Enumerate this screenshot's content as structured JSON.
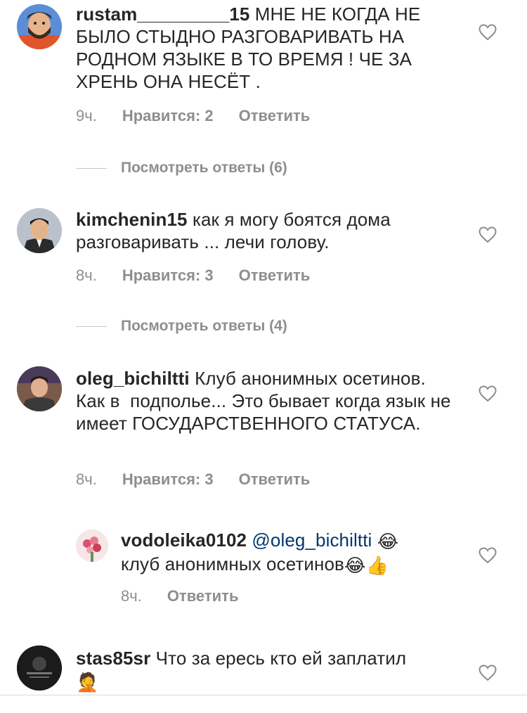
{
  "comments": [
    {
      "username": "rustam_________15",
      "text": " МНЕ НЕ КОГДА НЕ БЫЛО СТЫДНО РАЗГОВАРИВАТЬ НА РОДНОМ ЯЗЫКЕ В ТО ВРЕМЯ ! ЧЕ ЗА ХРЕНЬ ОНА НЕСЁТ .",
      "time": "9ч.",
      "likes": "Нравится: 2",
      "reply": "Ответить",
      "view_replies": "Посмотреть ответы (6)",
      "avatar_icon": "bearded-cartoon-man-avatar"
    },
    {
      "username": "kimchenin15",
      "text": " как я могу боятся дома разговаривать ... лечи голову.",
      "time": "8ч.",
      "likes": "Нравится: 3",
      "reply": "Ответить",
      "view_replies": "Посмотреть ответы (4)",
      "avatar_icon": "man-in-suit-avatar"
    },
    {
      "username": "oleg_bichiltti",
      "text": " Клуб анонимных осетинов. Как в  подполье... Это бывает когда язык не имеет ГОСУДАРСТВЕННОГО СТАТУСА.",
      "time": "8ч.",
      "likes": "Нравится: 3",
      "reply": "Ответить",
      "avatar_icon": "young-man-photo-avatar"
    },
    {
      "username": "vodoleika0102",
      "mention": "@oleg_bichiltti",
      "text": "клуб анонимных осетинов",
      "emoji_a": "😂",
      "emoji_b": "😂👍",
      "time": "8ч.",
      "reply": "Ответить",
      "avatar_icon": "flower-bouquet-avatar"
    },
    {
      "username": "stas85sr",
      "text": " Что за ересь кто ей заплатил",
      "emoji": "🤦",
      "avatar_icon": "dark-logo-avatar"
    }
  ],
  "icons": {
    "like": "heart-outline-icon"
  },
  "colors": {
    "text": "#262626",
    "secondary": "#8e8e8e",
    "mention": "#00376b",
    "divider": "#c7c7c7"
  }
}
